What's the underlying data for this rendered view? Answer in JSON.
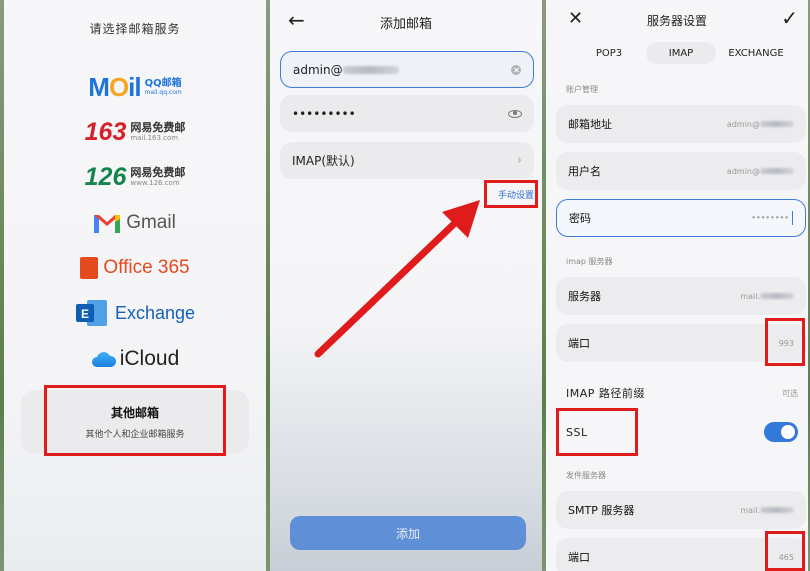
{
  "panel1": {
    "title": "请选择邮箱服务",
    "providers": {
      "qq": {
        "logo": "MOil",
        "cn": "QQ邮箱",
        "domain": "mail.qq.com"
      },
      "n163": {
        "number": "163",
        "cn": "网易免费邮",
        "domain": "mail.163.com"
      },
      "n126": {
        "number": "126",
        "cn": "网易免费邮",
        "domain": "www.126.com"
      },
      "gmail": {
        "name": "Gmail",
        "icon": "gmail-icon"
      },
      "office365": {
        "name": "Office 365",
        "icon": "office365-icon"
      },
      "exchange": {
        "name": "Exchange",
        "icon": "exchange-icon"
      },
      "icloud": {
        "name": "iCloud",
        "icon": "icloud-icon"
      }
    },
    "other": {
      "title": "其他邮箱",
      "subtitle": "其他个人和企业邮箱服务"
    }
  },
  "panel2": {
    "title": "添加邮箱",
    "email_value": "admin@",
    "password_value": "•••••••••",
    "protocol": "IMAP(默认)",
    "manual_setup": "手动设置",
    "add_button": "添加"
  },
  "panel3": {
    "title": "服务器设置",
    "tabs": [
      "POP3",
      "IMAP",
      "EXCHANGE"
    ],
    "active_tab": "IMAP",
    "account_section": "账户管理",
    "email_label": "邮箱地址",
    "email_value": "admin@",
    "username_label": "用户名",
    "username_value": "admin@",
    "password_label": "密码",
    "password_value": "••••••••",
    "imap_section": "imap 服务器",
    "server_label": "服务器",
    "server_value": "mail.",
    "port_label": "端口",
    "imap_port": "993",
    "prefix_label": "IMAP 路径前缀",
    "prefix_value": "可选",
    "ssl_label": "SSL",
    "ssl_enabled": true,
    "outgoing_section": "发件服务器",
    "smtp_label": "SMTP 服务器",
    "smtp_value": "mail.",
    "smtp_port_label": "端口",
    "smtp_port": "465"
  },
  "colors": {
    "accent": "#3279d8",
    "annotation_red": "#e01b1b"
  }
}
